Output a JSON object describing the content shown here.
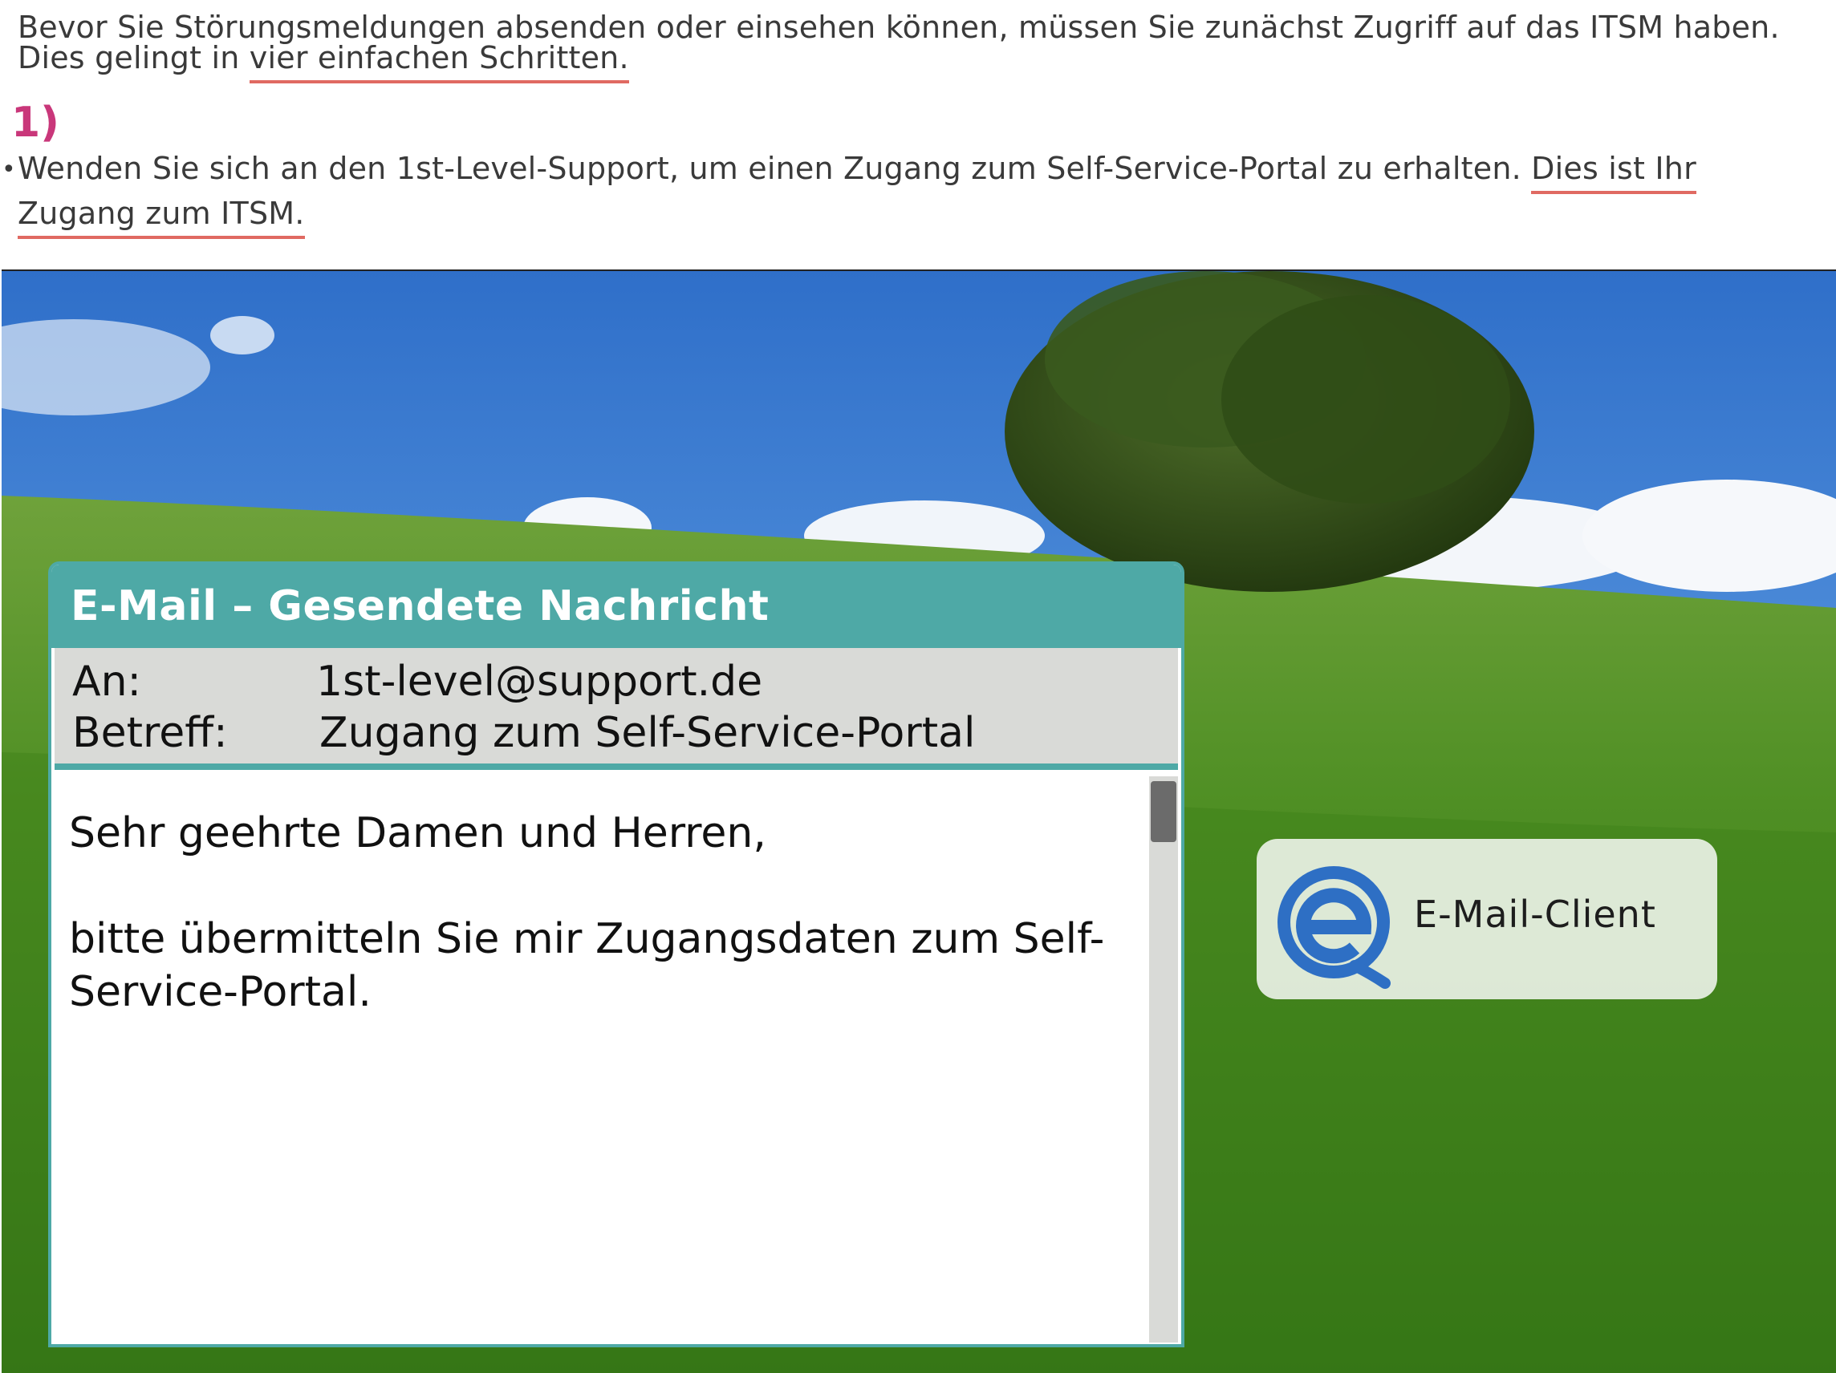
{
  "intro": {
    "line1": "Bevor Sie Störungsmeldungen absenden oder einsehen können, müssen Sie zunächst Zugriff auf das ITSM haben.",
    "line2_plain": "Dies gelingt in ",
    "line2_underlined": "vier einfachen Schritten.",
    "step_number": "1)",
    "bullet": "•",
    "line3_plain": "Wenden Sie sich an den 1st-Level-Support, um einen Zugang zum Self-Service-Portal zu erhalten. ",
    "line3_underlined": "Dies ist Ihr",
    "line4_underlined": "Zugang zum ITSM."
  },
  "mail": {
    "title": "E-Mail – Gesendete Nachricht",
    "to_label": "An:",
    "to_value": "1st-level@support.de",
    "subject_label": "Betreff:",
    "subject_value": "Zugang zum Self-Service-Portal",
    "body_greeting": "Sehr geehrte Damen und Herren,",
    "body_text": "bitte übermitteln Sie mir Zugangsdaten zum Self-Service-Portal."
  },
  "client": {
    "icon": "email-client-e-icon",
    "label": "E-Mail-Client"
  },
  "colors": {
    "accent_teal": "#4ea9a6",
    "step_pink": "#c9377a",
    "underline_red": "#e06a62",
    "icon_blue": "#2e6fc4"
  }
}
